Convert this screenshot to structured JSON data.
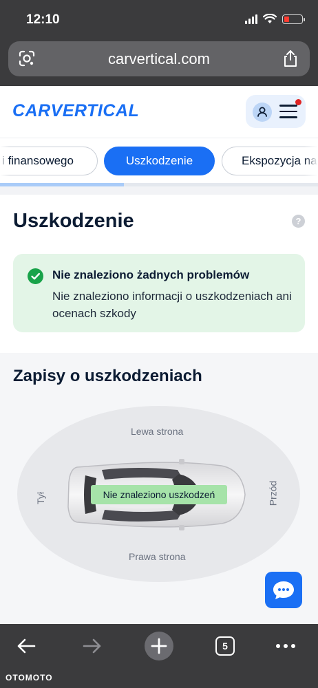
{
  "status_bar": {
    "time": "12:10"
  },
  "browser": {
    "url": "carvertical.com",
    "open_tabs": "5"
  },
  "site": {
    "logo_text": "CARVERTICAL"
  },
  "tabs": [
    {
      "label": "i finansowego",
      "active": false
    },
    {
      "label": "Uszkodzenie",
      "active": true
    },
    {
      "label": "Ekspozycja na",
      "active": false
    }
  ],
  "tabs_scroll_progress": 0.39,
  "damage": {
    "title": "Uszkodzenie",
    "help_glyph": "?",
    "alert": {
      "title": "Nie znaleziono żadnych problemów",
      "text": "Nie znaleziono informacji o uszkodzeniach ani ocenach szkody"
    }
  },
  "records": {
    "title": "Zapisy o uszkodzeniach",
    "labels": {
      "left_side": "Lewa strona",
      "right_side": "Prawa strona",
      "rear": "Tył",
      "front": "Przód"
    },
    "badge": "Nie znaleziono uszkodzeń"
  },
  "watermark": "OTOMOTO",
  "colors": {
    "brand_blue": "#1a6ff4",
    "success_green": "#19a34a",
    "alert_bg": "#e3f5e7",
    "badge_green": "#a6e3a9"
  }
}
